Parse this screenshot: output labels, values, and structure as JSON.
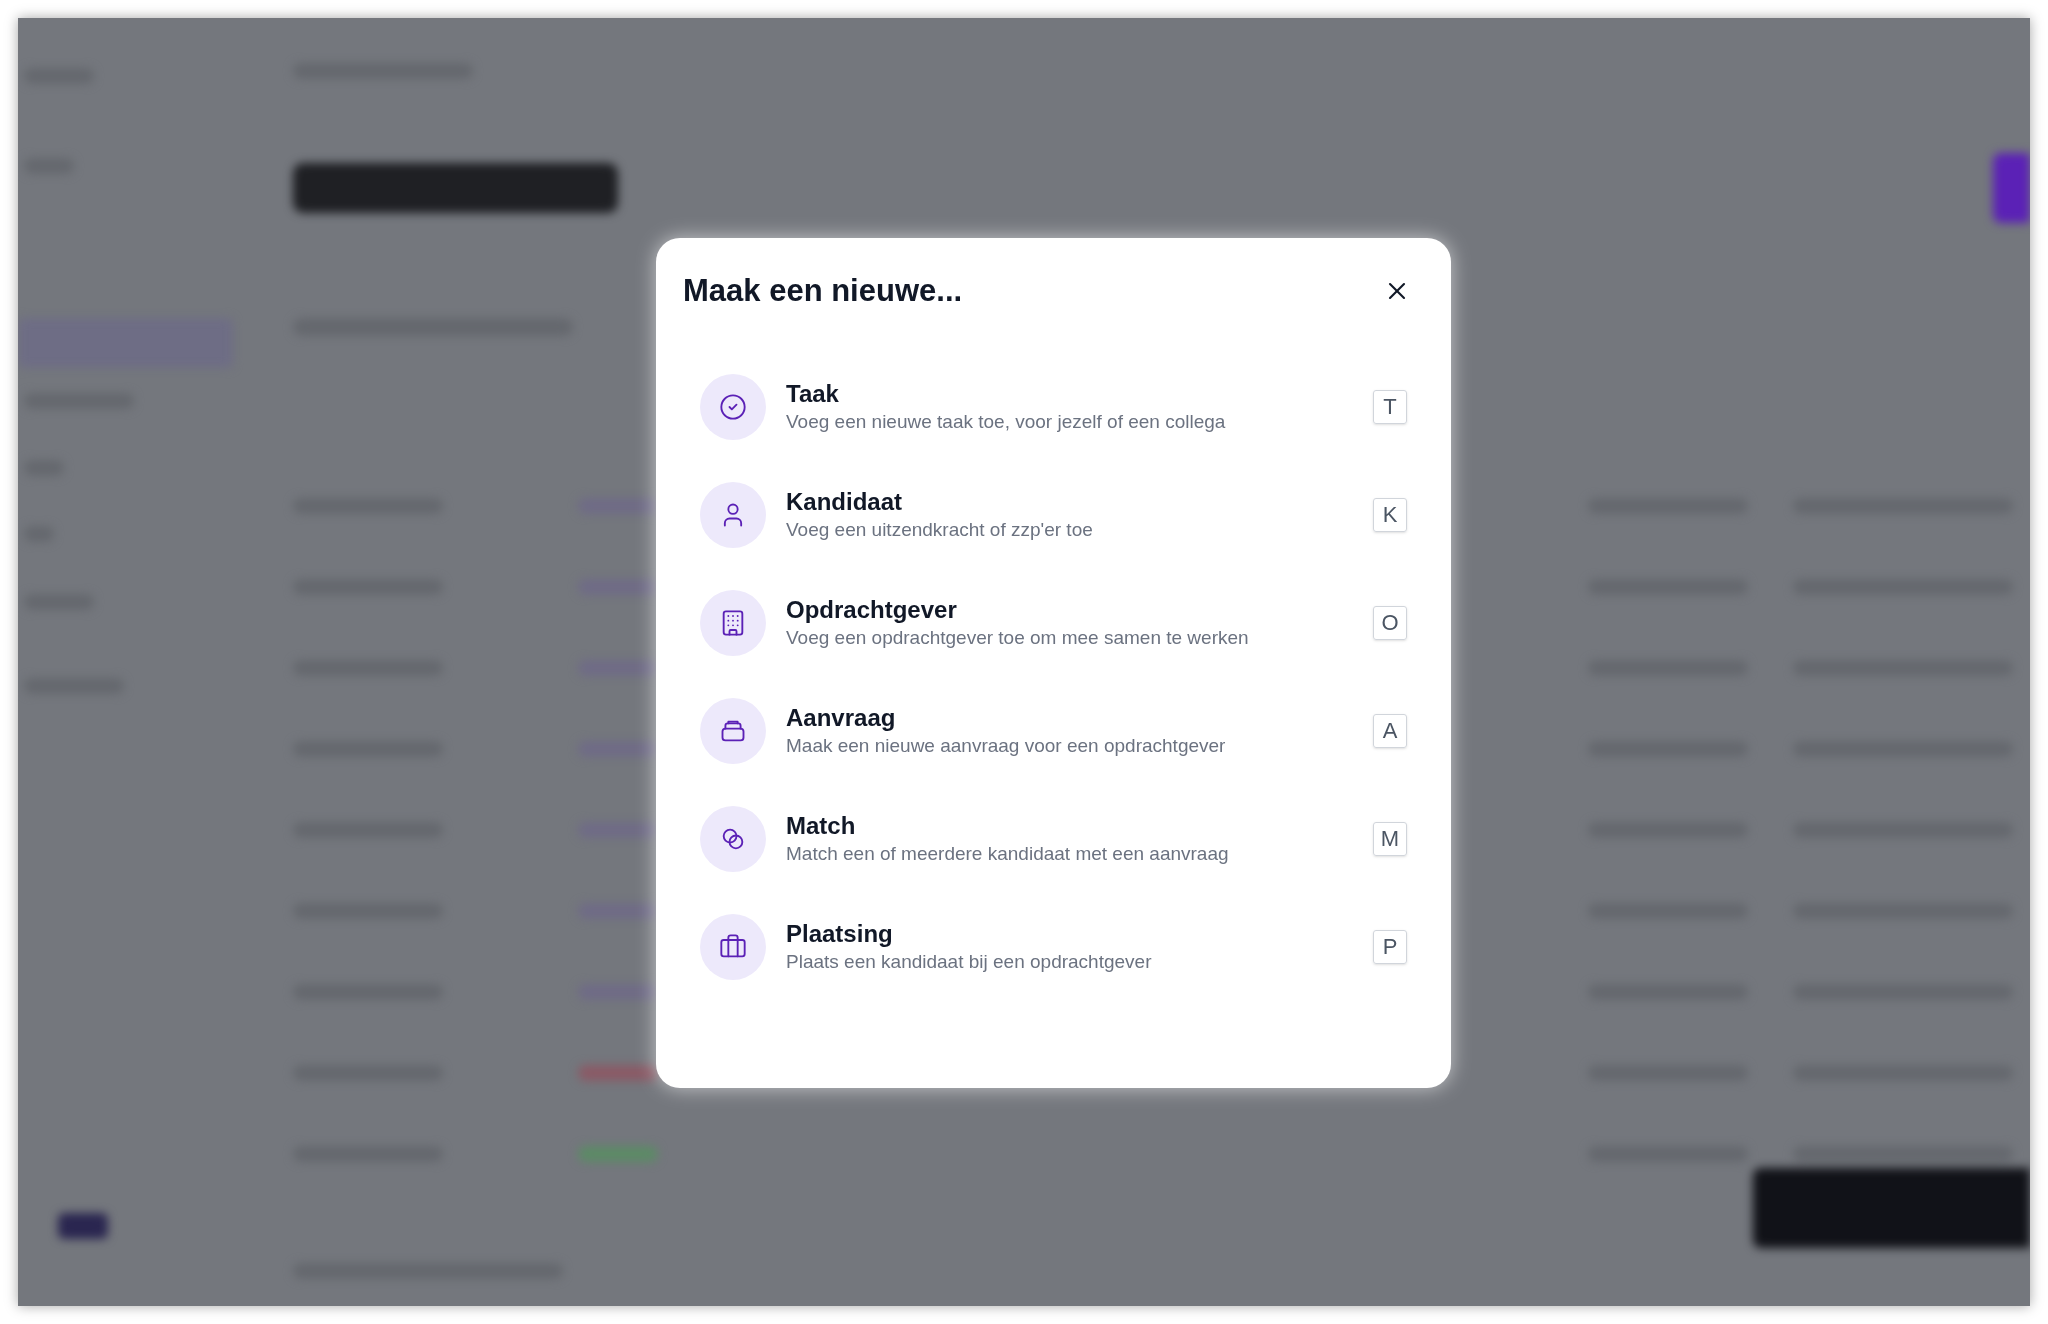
{
  "dialog": {
    "title": "Maak een nieuwe...",
    "items": [
      {
        "kind": "task",
        "title": "Taak",
        "description": "Voeg een nieuwe taak toe, voor jezelf of een collega",
        "shortcut": "T"
      },
      {
        "kind": "candidate",
        "title": "Kandidaat",
        "description": "Voeg een uitzendkracht of zzp'er toe",
        "shortcut": "K"
      },
      {
        "kind": "client",
        "title": "Opdrachtgever",
        "description": "Voeg een opdrachtgever toe om mee samen te werken",
        "shortcut": "O"
      },
      {
        "kind": "request",
        "title": "Aanvraag",
        "description": "Maak een nieuwe aanvraag voor een opdrachtgever",
        "shortcut": "A"
      },
      {
        "kind": "match",
        "title": "Match",
        "description": "Match een of meerdere kandidaat met een aanvraag",
        "shortcut": "M"
      },
      {
        "kind": "placement",
        "title": "Plaatsing",
        "description": "Plaats een kandidaat bij een opdrachtgever",
        "shortcut": "P"
      }
    ]
  }
}
